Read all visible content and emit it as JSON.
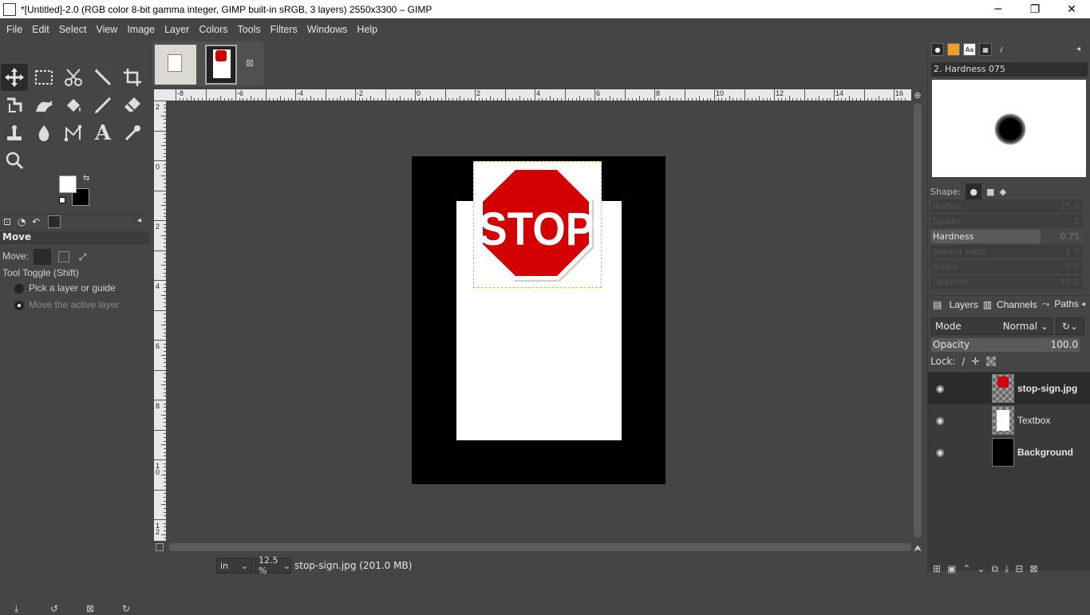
{
  "window": {
    "title": "*[Untitled]-2.0 (RGB color 8-bit gamma integer, GIMP built-in sRGB, 3 layers) 2550x3300 – GIMP",
    "minimize": "─",
    "maximize": "❐",
    "close": "✕"
  },
  "menu": [
    "File",
    "Edit",
    "Select",
    "View",
    "Image",
    "Layer",
    "Colors",
    "Tools",
    "Filters",
    "Windows",
    "Help"
  ],
  "tool_options": {
    "title": "Move",
    "move_label": "Move:",
    "toggle_label": "Tool Toggle  (Shift)",
    "option1": "Pick a layer or guide",
    "option2": "Move the active layer",
    "selected_option": 2
  },
  "ruler": {
    "h_labels": [
      "-8",
      "-6",
      "-4",
      "-2",
      "0",
      "2",
      "4",
      "6",
      "8",
      "10",
      "12",
      "14",
      "16"
    ],
    "v_labels": [
      "2",
      "0",
      "2",
      "4",
      "6",
      "8",
      "10",
      "12"
    ]
  },
  "canvas": {
    "stop_text": "STOP",
    "stop_color": "#d20000"
  },
  "status": {
    "unit": "in",
    "zoom": "12.5 %",
    "info": "stop-sign.jpg (201.0 MB)"
  },
  "brushes": {
    "name": "2. Hardness 075",
    "shape_label": "Shape:",
    "sliders": [
      {
        "label": "Radius",
        "value": "25.0",
        "active": false
      },
      {
        "label": "Spikes",
        "value": "2",
        "active": false
      },
      {
        "label": "Hardness",
        "value": "0.75",
        "active": true
      },
      {
        "label": "Aspect ratio",
        "value": "1.0",
        "active": false
      },
      {
        "label": "Angle",
        "value": "0.0",
        "active": false
      },
      {
        "label": "Spacing",
        "value": "10.0",
        "active": false
      }
    ]
  },
  "layers_panel": {
    "tabs": [
      "Layers",
      "Channels",
      "Paths"
    ],
    "mode_label": "Mode",
    "mode_value": "Normal",
    "opacity_label": "Opacity",
    "opacity_value": "100.0",
    "lock_label": "Lock:",
    "layers": [
      {
        "name": "stop-sign.jpg",
        "selected": true
      },
      {
        "name": "Textbox",
        "selected": false
      },
      {
        "name": "Background",
        "selected": false
      }
    ]
  }
}
